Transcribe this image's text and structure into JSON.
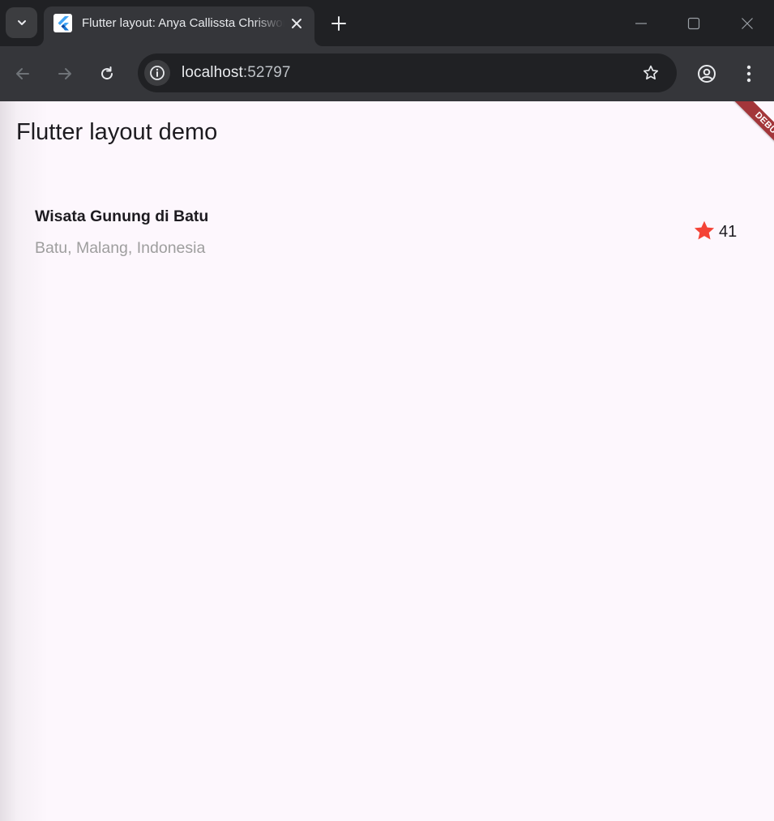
{
  "browser": {
    "tab": {
      "title": "Flutter layout: Anya Callissta Chrisworo"
    },
    "address": {
      "host": "localhost",
      "port": ":52797"
    },
    "icons": {
      "tab_search": "chevron-down-icon",
      "favicon": "flutter-logo-icon",
      "tab_close": "close-icon",
      "new_tab": "plus-icon",
      "minimize": "minimize-icon",
      "maximize": "maximize-icon",
      "close_window": "close-icon",
      "back": "arrow-left-icon",
      "forward": "arrow-right-icon",
      "reload": "reload-icon",
      "site_info": "info-icon",
      "bookmark": "star-outline-icon",
      "profile": "profile-icon",
      "menu": "more-vert-icon"
    }
  },
  "app": {
    "appbar_title": "Flutter layout demo",
    "title_section": {
      "title": "Wisata Gunung di Batu",
      "subtitle": "Batu, Malang, Indonesia",
      "rating": "41",
      "star_color": "#f44336"
    },
    "debug_banner": "DEBUG",
    "colors": {
      "background": "#fdf7fd",
      "banner": "#a3363a"
    }
  }
}
